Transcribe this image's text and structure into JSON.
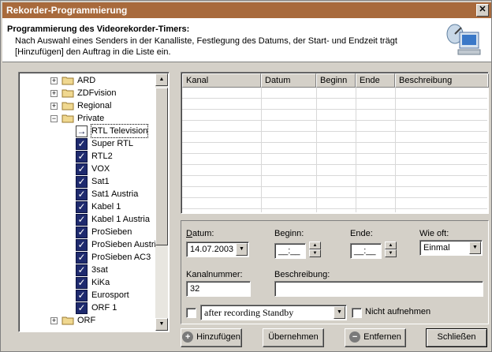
{
  "window": {
    "title": "Rekorder-Programmierung",
    "close_glyph": "✕"
  },
  "header": {
    "title": "Programmierung des Videorekorder-Timers:",
    "description": "Nach Auswahl eines Senders in der Kanalliste, Festlegung des Datums, der Start- und Endzeit trägt [Hinzufügen] den Auftrag in die Liste ein.",
    "logo_icon": "computer-satellite-icon"
  },
  "tree": {
    "items": [
      {
        "label": "ARD",
        "kind": "folder",
        "expander": "+"
      },
      {
        "label": "ZDFvision",
        "kind": "folder",
        "expander": "+"
      },
      {
        "label": "Regional",
        "kind": "folder",
        "expander": "+"
      },
      {
        "label": "Private",
        "kind": "folder-open",
        "expander": "−"
      },
      {
        "label": "RTL Television",
        "kind": "arrow"
      },
      {
        "label": "Super RTL",
        "kind": "check"
      },
      {
        "label": "RTL2",
        "kind": "check"
      },
      {
        "label": "VOX",
        "kind": "check"
      },
      {
        "label": "Sat1",
        "kind": "check"
      },
      {
        "label": "Sat1 Austria",
        "kind": "check"
      },
      {
        "label": "Kabel 1",
        "kind": "check"
      },
      {
        "label": "Kabel 1 Austria",
        "kind": "check"
      },
      {
        "label": "ProSieben",
        "kind": "check"
      },
      {
        "label": "ProSieben Austri",
        "kind": "check"
      },
      {
        "label": "ProSieben AC3",
        "kind": "check"
      },
      {
        "label": "3sat",
        "kind": "check"
      },
      {
        "label": "KiKa",
        "kind": "check"
      },
      {
        "label": "Eurosport",
        "kind": "check"
      },
      {
        "label": "ORF 1",
        "kind": "check"
      },
      {
        "label": "ORF",
        "kind": "folder",
        "expander": "+"
      }
    ]
  },
  "listview": {
    "columns": [
      "Kanal",
      "Datum",
      "Beginn",
      "Ende",
      "Beschreibung"
    ],
    "rows": []
  },
  "form": {
    "datum_label": "Datum:",
    "datum_value": "14.07.2003",
    "beginn_label": "Beginn:",
    "beginn_value": "__:__",
    "ende_label": "Ende:",
    "ende_value": "__:__",
    "wieoft_label": "Wie oft:",
    "wieoft_value": "Einmal",
    "kanalnummer_label": "Kanalnummer:",
    "kanalnummer_value": "32",
    "beschreibung_label": "Beschreibung:",
    "beschreibung_value": "",
    "standby_checked": false,
    "standby_value": "after recording Standby",
    "nicht_aufnehmen_label": "Nicht aufnehmen",
    "nicht_aufnehmen_checked": false
  },
  "buttons": {
    "add": "Hinzufügen",
    "apply": "Übernehmen",
    "remove": "Entfernen",
    "close": "Schließen"
  }
}
